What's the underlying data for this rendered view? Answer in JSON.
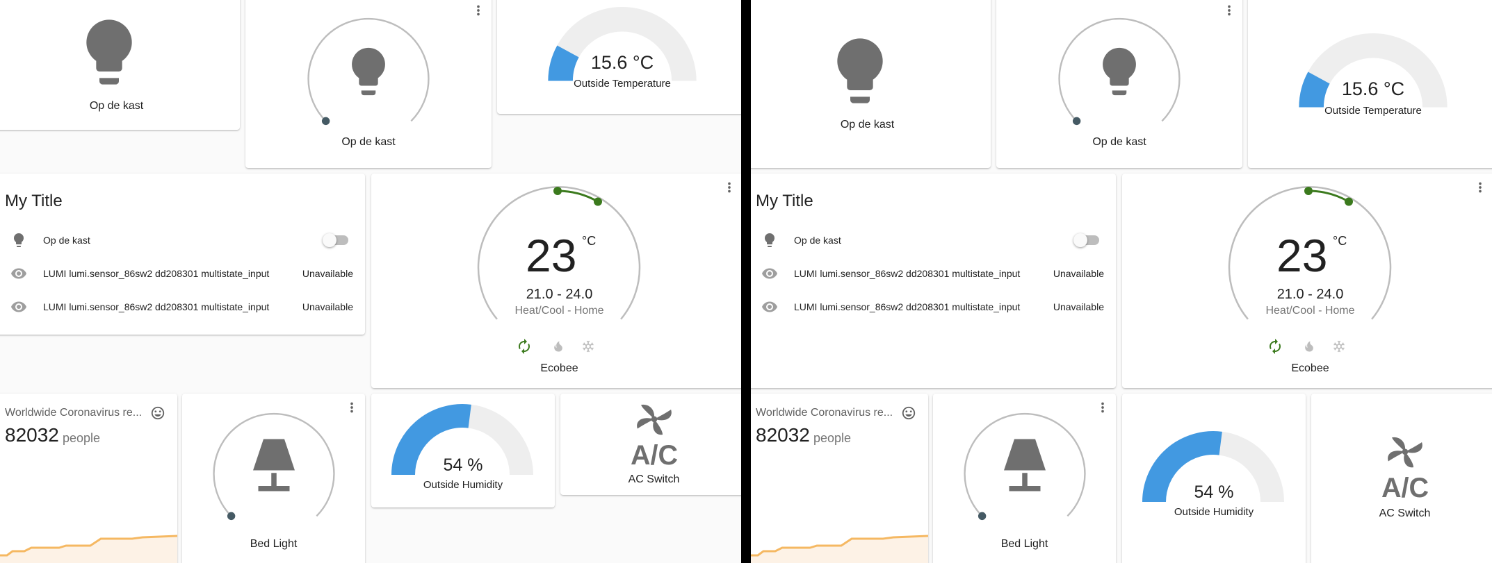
{
  "colors": {
    "icon_gray": "#6f6f6f",
    "slider_track": "#bdbdbd",
    "gauge_blue": "#4299e1",
    "gauge_bg": "#eeeeee",
    "heat_cool_green": "#3b7a1d",
    "graph_orange": "#f5b862",
    "graph_fill": "#fdf2e6"
  },
  "panes": [
    {
      "light_card_1": {
        "name": "Op de kast",
        "icon": "lightbulb-icon"
      },
      "light_card_2": {
        "name": "Op de kast",
        "icon": "lightbulb-icon",
        "brightness": 0
      },
      "temp_gauge": {
        "value": "15.6 °C",
        "name": "Outside Temperature",
        "fraction": 0.156
      },
      "entities": {
        "title": "My Title",
        "rows": [
          {
            "name": "Op de kast",
            "icon": "lightbulb-icon",
            "state": "",
            "toggle": "off"
          },
          {
            "name": "LUMI lumi.sensor_86sw2 dd208301 multistate_input",
            "icon": "eye-icon",
            "state": "Unavailable"
          },
          {
            "name": "LUMI lumi.sensor_86sw2 dd208301 multistate_input",
            "icon": "eye-icon",
            "state": "Unavailable"
          }
        ]
      },
      "thermostat": {
        "temperature": "23",
        "unit": "°C",
        "range": "21.0 - 24.0",
        "mode": "Heat/Cool - Home",
        "name": "Ecobee",
        "modes": [
          "heat-cool-icon",
          "flame-icon",
          "snowflake-icon"
        ]
      },
      "sensor": {
        "name": "Worldwide Coronavirus re...",
        "value": "82032",
        "unit": "people",
        "icon": "smile-icon"
      },
      "bed_light": {
        "name": "Bed Light",
        "icon": "lamp-icon",
        "brightness": 0
      },
      "humidity_gauge": {
        "value": "54 %",
        "name": "Outside Humidity",
        "fraction": 0.54
      },
      "ac_switch": {
        "name": "AC Switch",
        "icon": "air-conditioner-icon",
        "icon_text": "A/C"
      }
    },
    {
      "light_card_1": {
        "name": "Op de kast",
        "icon": "lightbulb-icon"
      },
      "light_card_2": {
        "name": "Op de kast",
        "icon": "lightbulb-icon",
        "brightness": 0
      },
      "temp_gauge": {
        "value": "15.6 °C",
        "name": "Outside Temperature",
        "fraction": 0.156
      },
      "entities": {
        "title": "My Title",
        "rows": [
          {
            "name": "Op de kast",
            "icon": "lightbulb-icon",
            "state": "",
            "toggle": "off"
          },
          {
            "name": "LUMI lumi.sensor_86sw2 dd208301 multistate_input",
            "icon": "eye-icon",
            "state": "Unavailable"
          },
          {
            "name": "LUMI lumi.sensor_86sw2 dd208301 multistate_input",
            "icon": "eye-icon",
            "state": "Unavailable"
          }
        ]
      },
      "thermostat": {
        "temperature": "23",
        "unit": "°C",
        "range": "21.0 - 24.0",
        "mode": "Heat/Cool - Home",
        "name": "Ecobee",
        "modes": [
          "heat-cool-icon",
          "flame-icon",
          "snowflake-icon"
        ]
      },
      "sensor": {
        "name": "Worldwide Coronavirus re...",
        "value": "82032",
        "unit": "people",
        "icon": "smile-icon"
      },
      "bed_light": {
        "name": "Bed Light",
        "icon": "lamp-icon",
        "brightness": 0
      },
      "humidity_gauge": {
        "value": "54 %",
        "name": "Outside Humidity",
        "fraction": 0.54
      },
      "ac_switch": {
        "name": "AC Switch",
        "icon": "air-conditioner-icon",
        "icon_text": "A/C"
      }
    }
  ]
}
